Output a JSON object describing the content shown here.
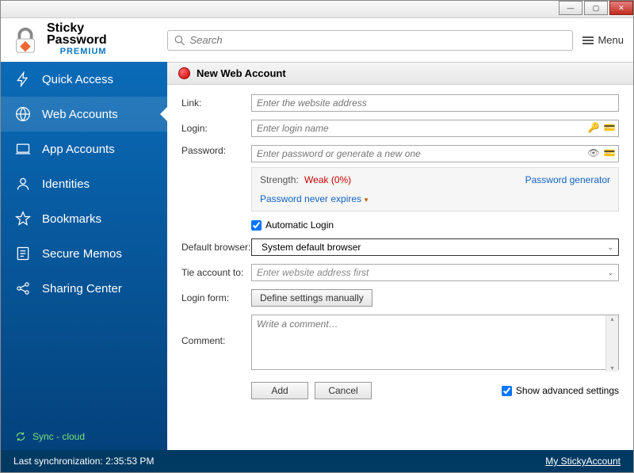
{
  "window": {
    "title": "Sticky Password PREMIUM"
  },
  "logo": {
    "line1": "Sticky",
    "line2": "Password",
    "line3": "PREMIUM"
  },
  "search": {
    "placeholder": "Search"
  },
  "menu_label": "Menu",
  "sidebar": {
    "items": [
      {
        "label": "Quick Access",
        "icon": "bolt"
      },
      {
        "label": "Web Accounts",
        "icon": "globe",
        "active": true
      },
      {
        "label": "App Accounts",
        "icon": "laptop"
      },
      {
        "label": "Identities",
        "icon": "person"
      },
      {
        "label": "Bookmarks",
        "icon": "star"
      },
      {
        "label": "Secure Memos",
        "icon": "memo"
      },
      {
        "label": "Sharing Center",
        "icon": "share"
      }
    ],
    "sync_label": "Sync - cloud"
  },
  "panel": {
    "title": "New Web Account"
  },
  "form": {
    "link_label": "Link:",
    "link_placeholder": "Enter the website address",
    "login_label": "Login:",
    "login_placeholder": "Enter login name",
    "password_label": "Password:",
    "password_placeholder": "Enter password or generate a new one",
    "strength_label": "Strength:",
    "strength_value": "Weak (0%)",
    "password_generator": "Password generator",
    "expire_label": "Password never expires",
    "auto_login_label": "Automatic Login",
    "auto_login_checked": true,
    "default_browser_label": "Default browser:",
    "default_browser_value": "System default browser",
    "tie_account_label": "Tie account to:",
    "tie_account_value": "Enter website address first",
    "login_form_label": "Login form:",
    "login_form_button": "Define settings manually",
    "comment_label": "Comment:",
    "comment_placeholder": "Write a comment…",
    "add_button": "Add",
    "cancel_button": "Cancel",
    "show_advanced_label": "Show advanced settings",
    "show_advanced_checked": true
  },
  "status": {
    "last_sync_label": "Last synchronization: 2:35:53 PM",
    "account_link": "My StickyAccount"
  }
}
